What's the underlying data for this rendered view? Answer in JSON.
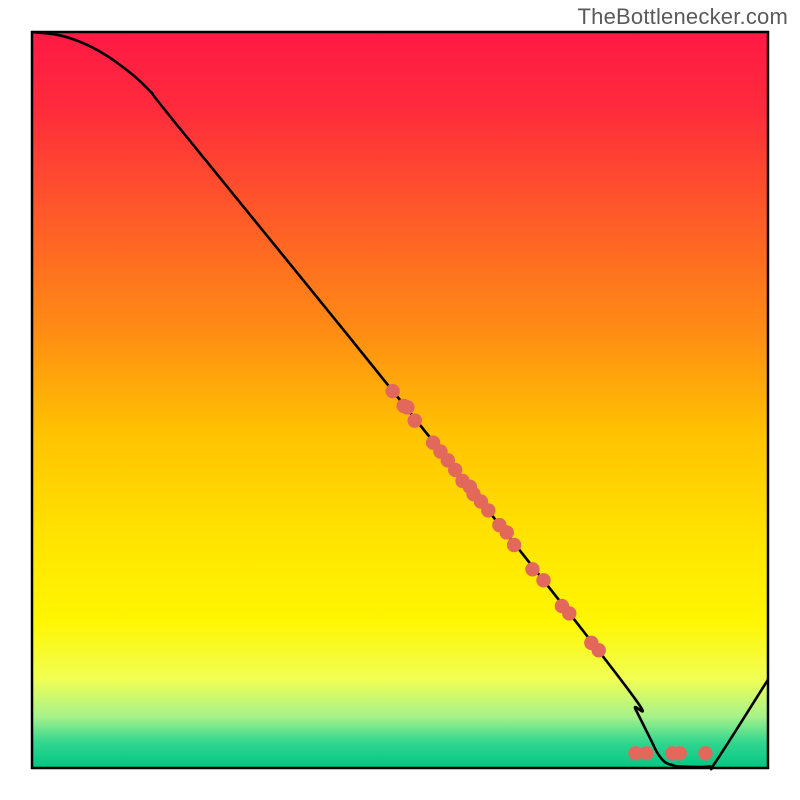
{
  "attribution": "TheBottlenecker.com",
  "chart_data": {
    "type": "line",
    "title": "",
    "xlabel": "",
    "ylabel": "",
    "xlim": [
      0,
      100
    ],
    "ylim": [
      0,
      100
    ],
    "gradient_stops": [
      {
        "offset": 0.0,
        "color": "#ff1a44"
      },
      {
        "offset": 0.1,
        "color": "#ff2a3c"
      },
      {
        "offset": 0.25,
        "color": "#ff5a28"
      },
      {
        "offset": 0.4,
        "color": "#ff8a14"
      },
      {
        "offset": 0.55,
        "color": "#ffc400"
      },
      {
        "offset": 0.7,
        "color": "#ffe600"
      },
      {
        "offset": 0.8,
        "color": "#fff600"
      },
      {
        "offset": 0.88,
        "color": "#f0ff55"
      },
      {
        "offset": 0.93,
        "color": "#a6f28a"
      },
      {
        "offset": 0.965,
        "color": "#33d68f"
      },
      {
        "offset": 1.0,
        "color": "#00c682"
      }
    ],
    "curve": [
      {
        "x": 0.0,
        "y": 100.0
      },
      {
        "x": 4.0,
        "y": 99.5
      },
      {
        "x": 8.0,
        "y": 98.0
      },
      {
        "x": 12.0,
        "y": 95.5
      },
      {
        "x": 16.0,
        "y": 92.0
      },
      {
        "x": 20.0,
        "y": 87.0
      },
      {
        "x": 50.0,
        "y": 50.0
      },
      {
        "x": 80.0,
        "y": 12.0
      },
      {
        "x": 82.0,
        "y": 8.0
      },
      {
        "x": 84.0,
        "y": 4.0
      },
      {
        "x": 85.0,
        "y": 2.0
      },
      {
        "x": 86.0,
        "y": 0.8
      },
      {
        "x": 87.0,
        "y": 0.4
      },
      {
        "x": 88.0,
        "y": 0.2
      },
      {
        "x": 92.0,
        "y": 0.2
      },
      {
        "x": 93.0,
        "y": 1.0
      },
      {
        "x": 100.0,
        "y": 12.0
      }
    ],
    "points": [
      {
        "x": 49.0,
        "y": 51.2
      },
      {
        "x": 50.5,
        "y": 49.2
      },
      {
        "x": 51.0,
        "y": 49.0
      },
      {
        "x": 52.0,
        "y": 47.2
      },
      {
        "x": 54.5,
        "y": 44.2
      },
      {
        "x": 55.5,
        "y": 43.0
      },
      {
        "x": 56.5,
        "y": 41.8
      },
      {
        "x": 57.5,
        "y": 40.5
      },
      {
        "x": 58.5,
        "y": 39.0
      },
      {
        "x": 59.5,
        "y": 38.2
      },
      {
        "x": 60.0,
        "y": 37.2
      },
      {
        "x": 61.0,
        "y": 36.2
      },
      {
        "x": 62.0,
        "y": 35.0
      },
      {
        "x": 63.5,
        "y": 33.0
      },
      {
        "x": 64.5,
        "y": 32.0
      },
      {
        "x": 65.5,
        "y": 30.3
      },
      {
        "x": 68.0,
        "y": 27.0
      },
      {
        "x": 69.5,
        "y": 25.5
      },
      {
        "x": 72.0,
        "y": 22.0
      },
      {
        "x": 73.0,
        "y": 21.0
      },
      {
        "x": 76.0,
        "y": 17.0
      },
      {
        "x": 77.0,
        "y": 16.0
      },
      {
        "x": 82.0,
        "y": 2.0
      },
      {
        "x": 83.5,
        "y": 2.0
      },
      {
        "x": 87.0,
        "y": 2.0
      },
      {
        "x": 88.0,
        "y": 2.0
      },
      {
        "x": 91.5,
        "y": 2.0
      }
    ],
    "point_color": "#e2685b",
    "curve_color": "#000000",
    "plot_border_color": "#000000",
    "green_band": {
      "y_top": 3.6,
      "color_top": "#33d68f",
      "color_bottom": "#00c581"
    }
  }
}
